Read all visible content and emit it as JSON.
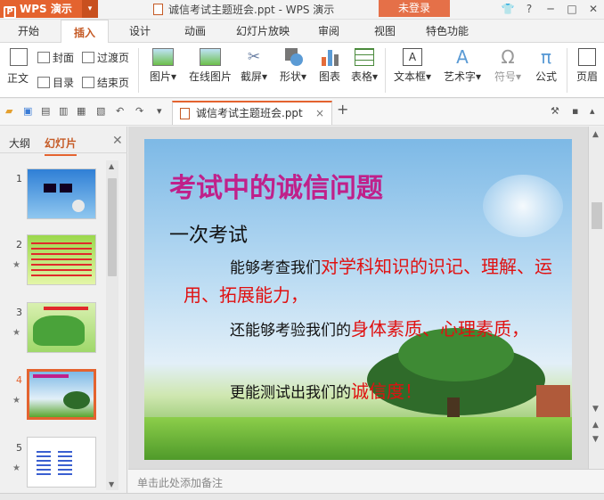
{
  "titlebar": {
    "app_name": "WPS 演示",
    "doc_title": "诚信考试主题班会.ppt - WPS 演示",
    "login_label": "未登录"
  },
  "menu": {
    "tabs": [
      "开始",
      "插入",
      "设计",
      "动画",
      "幻灯片放映",
      "审阅",
      "视图",
      "特色功能"
    ]
  },
  "ribbon": {
    "items": {
      "cover": "封面",
      "transition": "过渡页",
      "body": "正文",
      "toc": "目录",
      "end_page": "结束页",
      "picture": "图片",
      "online_picture": "在线图片",
      "screenshot": "截屏",
      "shape": "形状",
      "chart": "图表",
      "table": "表格",
      "textbox": "文本框",
      "wordart": "艺术字",
      "symbol": "符号",
      "formula": "公式",
      "header": "页眉"
    }
  },
  "doc_tab": {
    "label": "诚信考试主题班会.ppt"
  },
  "left_panel": {
    "tab_outline": "大纲",
    "tab_slides": "幻灯片",
    "slide_numbers": [
      "1",
      "2",
      "3",
      "4",
      "5"
    ],
    "selected": "4"
  },
  "slide": {
    "title": "考试中的诚信问题",
    "subtitle": "一次考试",
    "para1_prefix": "能够考查我们",
    "para1_hl": "对学科知识的识记、理解、运用、拓展能力，",
    "para2_prefix": "还能够考验我们的",
    "para2_hl": "身体素质、心理素质，",
    "para3_prefix": "更能测试出我们的",
    "para3_hl": "诚信度！"
  },
  "notes": {
    "placeholder": "单击此处添加备注"
  },
  "colors": {
    "accent": "#e4632f",
    "title_magenta": "#c0208a",
    "highlight_red": "#e01010"
  }
}
